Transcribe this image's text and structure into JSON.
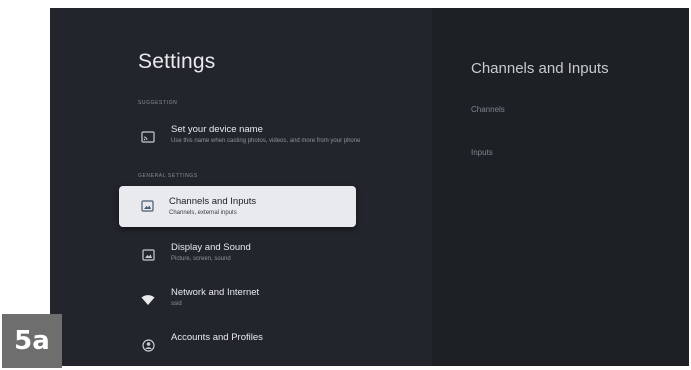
{
  "settings": {
    "title": "Settings",
    "sections": {
      "suggestion": "SUGGESTION",
      "general": "GENERAL SETTINGS"
    },
    "items": [
      {
        "title": "Set your device name",
        "subtitle": "Use this name when casting photos, videos, and more from your phone",
        "icon": "cast-icon"
      },
      {
        "title": "Channels and Inputs",
        "subtitle": "Channels, external inputs",
        "icon": "input-icon"
      },
      {
        "title": "Display and Sound",
        "subtitle": "Picture, screen, sound",
        "icon": "display-icon"
      },
      {
        "title": "Network and Internet",
        "subtitle": "ssid",
        "icon": "wifi-icon"
      },
      {
        "title": "Accounts and Profiles",
        "subtitle": "",
        "icon": "account-icon"
      }
    ]
  },
  "detail": {
    "title": "Channels and Inputs",
    "items": [
      "Channels",
      "Inputs"
    ]
  },
  "badge": "5a",
  "colors": {
    "background": "#202124",
    "focused_item": "#e8eaed",
    "badge": "#6e6e6e"
  }
}
